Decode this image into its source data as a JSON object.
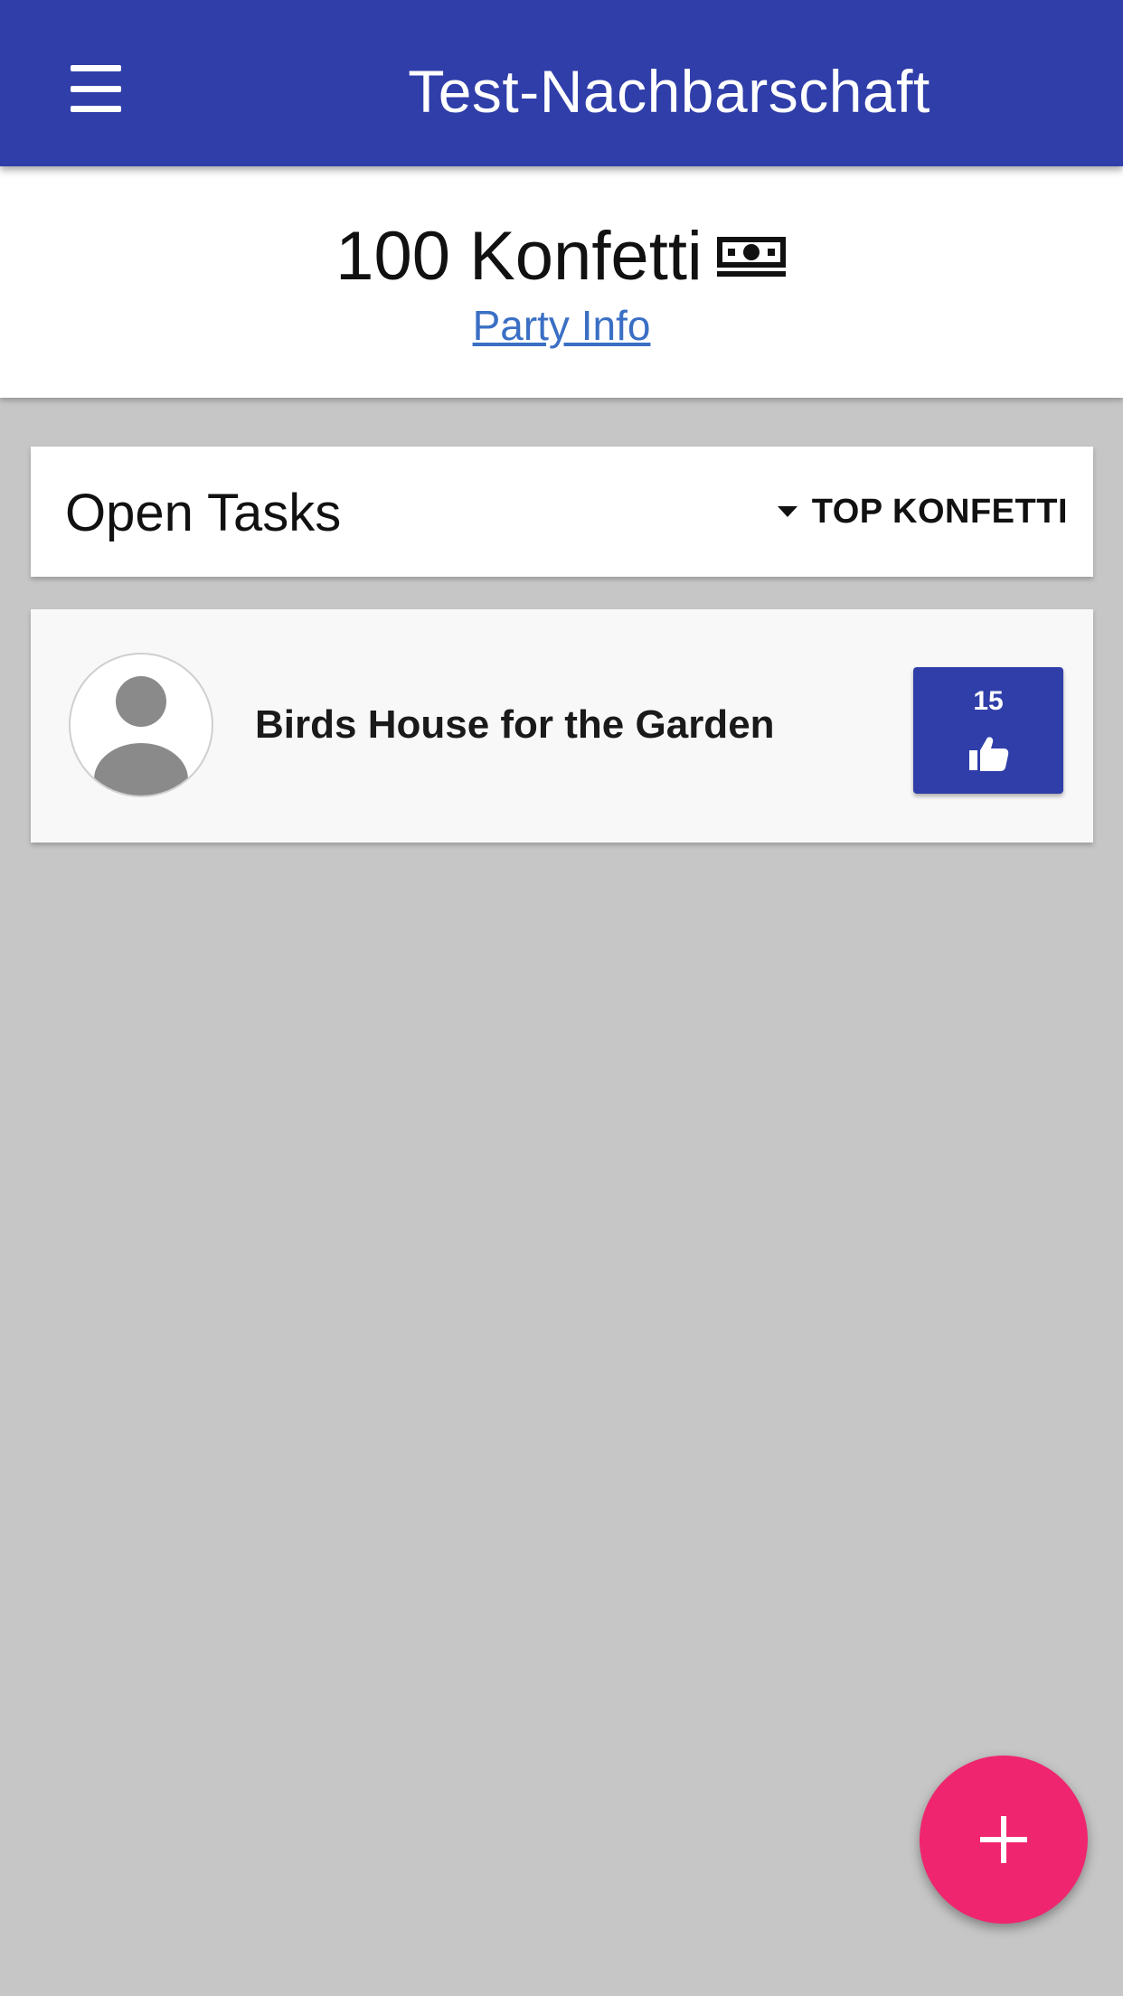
{
  "appbar": {
    "title": "Test-Nachbarschaft",
    "menu_icon": "hamburger-menu-icon",
    "color": "#303ea9"
  },
  "balance": {
    "amount_text": "100 Konfetti",
    "currency_icon": "money-bill-icon",
    "party_info_link": "Party Info"
  },
  "tasks": {
    "title": "Open Tasks",
    "sort_label": "TOP KONFETTI",
    "sort_icon": "caret-down-icon",
    "items": [
      {
        "title": "Birds House for the Garden",
        "avatar_icon": "user-placeholder-icon",
        "votes": "15",
        "vote_icon": "thumbs-up-icon"
      }
    ]
  },
  "fab": {
    "icon": "plus-icon",
    "color": "#f0256f"
  }
}
